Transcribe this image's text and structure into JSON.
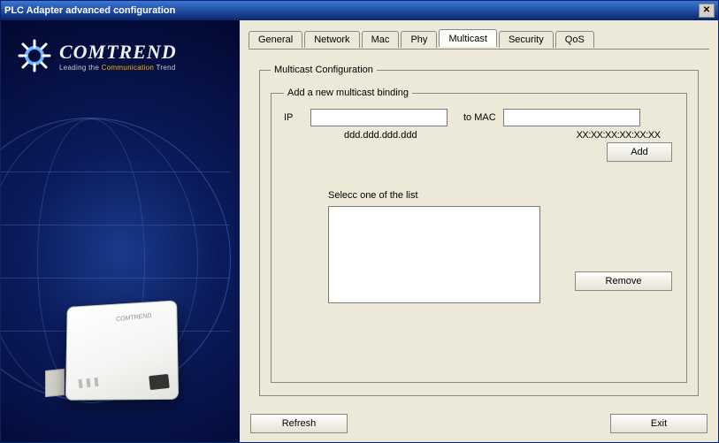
{
  "window": {
    "title": "PLC Adapter advanced configuration"
  },
  "brand": {
    "name": "COMTREND",
    "tagline_pre": "Leading the ",
    "tagline_hi": "Communication",
    "tagline_post": " Trend"
  },
  "tabs": {
    "general": "General",
    "network": "Network",
    "mac": "Mac",
    "phy": "Phy",
    "multicast": "Multicast",
    "security": "Security",
    "qos": "QoS"
  },
  "multicast": {
    "group_title": "Multicast Configuration",
    "add_group_title": "Add a new multicast binding",
    "ip_label": "IP",
    "ip_value": "",
    "ip_hint": "ddd.ddd.ddd.ddd",
    "mac_label": "to MAC",
    "mac_value": "",
    "mac_hint": "XX:XX:XX:XX:XX:XX",
    "add_button": "Add",
    "list_label": "Selecc one of the list",
    "remove_button": "Remove"
  },
  "footer": {
    "refresh": "Refresh",
    "exit": "Exit"
  }
}
